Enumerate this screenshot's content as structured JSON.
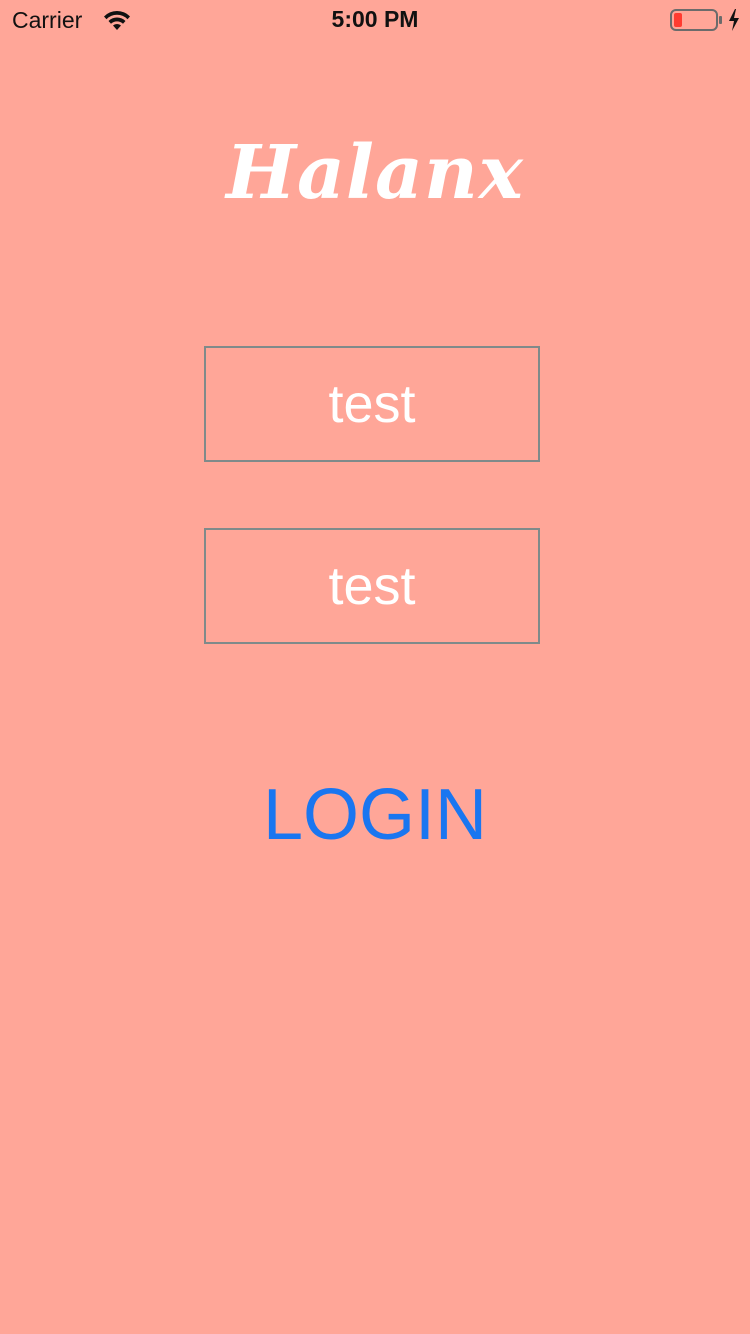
{
  "status_bar": {
    "carrier": "Carrier",
    "time": "5:00 PM",
    "wifi_icon": "wifi-icon",
    "battery_icon": "battery-low-icon",
    "charging_icon": "bolt-icon",
    "battery_color": "#FF3B30"
  },
  "app": {
    "title": "Halanx"
  },
  "form": {
    "username_value": "test",
    "password_value": "test",
    "login_label": "LOGIN"
  },
  "colors": {
    "background": "#FFA698",
    "accent": "#1A76F0",
    "field_border": "#7F8A8A"
  }
}
